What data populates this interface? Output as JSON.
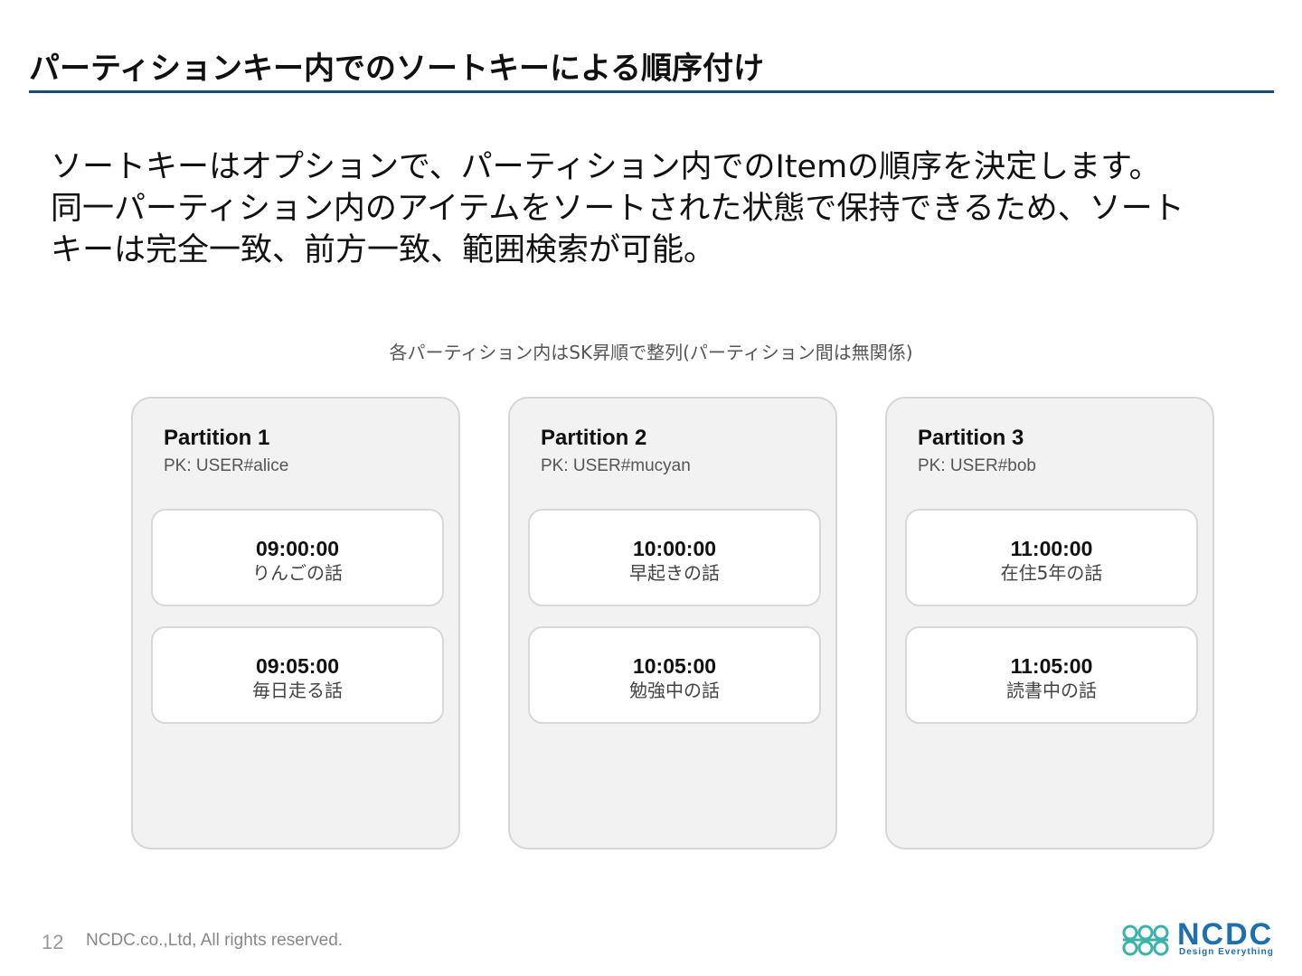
{
  "slide": {
    "title": "パーティションキー内でのソートキーによる順序付け",
    "lead_lines": [
      "ソートキーはオプションで、パーティション内でのItemの順序を決定します。",
      "同一パーティション内のアイテムをソートされた状態で保持できるため、ソート",
      "キーは完全一致、前方一致、範囲検索が可能。"
    ],
    "caption": "各パーティション内はSK昇順で整列(パーティション間は無関係)"
  },
  "partitions": [
    {
      "name": "Partition 1",
      "pk": "PK: USER#alice",
      "items": [
        {
          "sk": "09:00:00",
          "text": "りんごの話"
        },
        {
          "sk": "09:05:00",
          "text": "毎日走る話"
        }
      ]
    },
    {
      "name": "Partition 2",
      "pk": "PK: USER#mucyan",
      "items": [
        {
          "sk": "10:00:00",
          "text": "早起きの話"
        },
        {
          "sk": "10:05:00",
          "text": "勉強中の話"
        }
      ]
    },
    {
      "name": "Partition 3",
      "pk": "PK: USER#bob",
      "items": [
        {
          "sk": "11:00:00",
          "text": "在住5年の話"
        },
        {
          "sk": "11:05:00",
          "text": "読書中の話"
        }
      ]
    }
  ],
  "footer": {
    "page_number": "12",
    "copyright": "NCDC.co.,Ltd, All rights reserved.",
    "logo_text": "NCDC",
    "logo_tagline": "Design Everything",
    "logo_icon": "ncdc-logo-mark-icon",
    "accent_color": "#1e4a72",
    "logo_color": "#1d6fb0"
  }
}
